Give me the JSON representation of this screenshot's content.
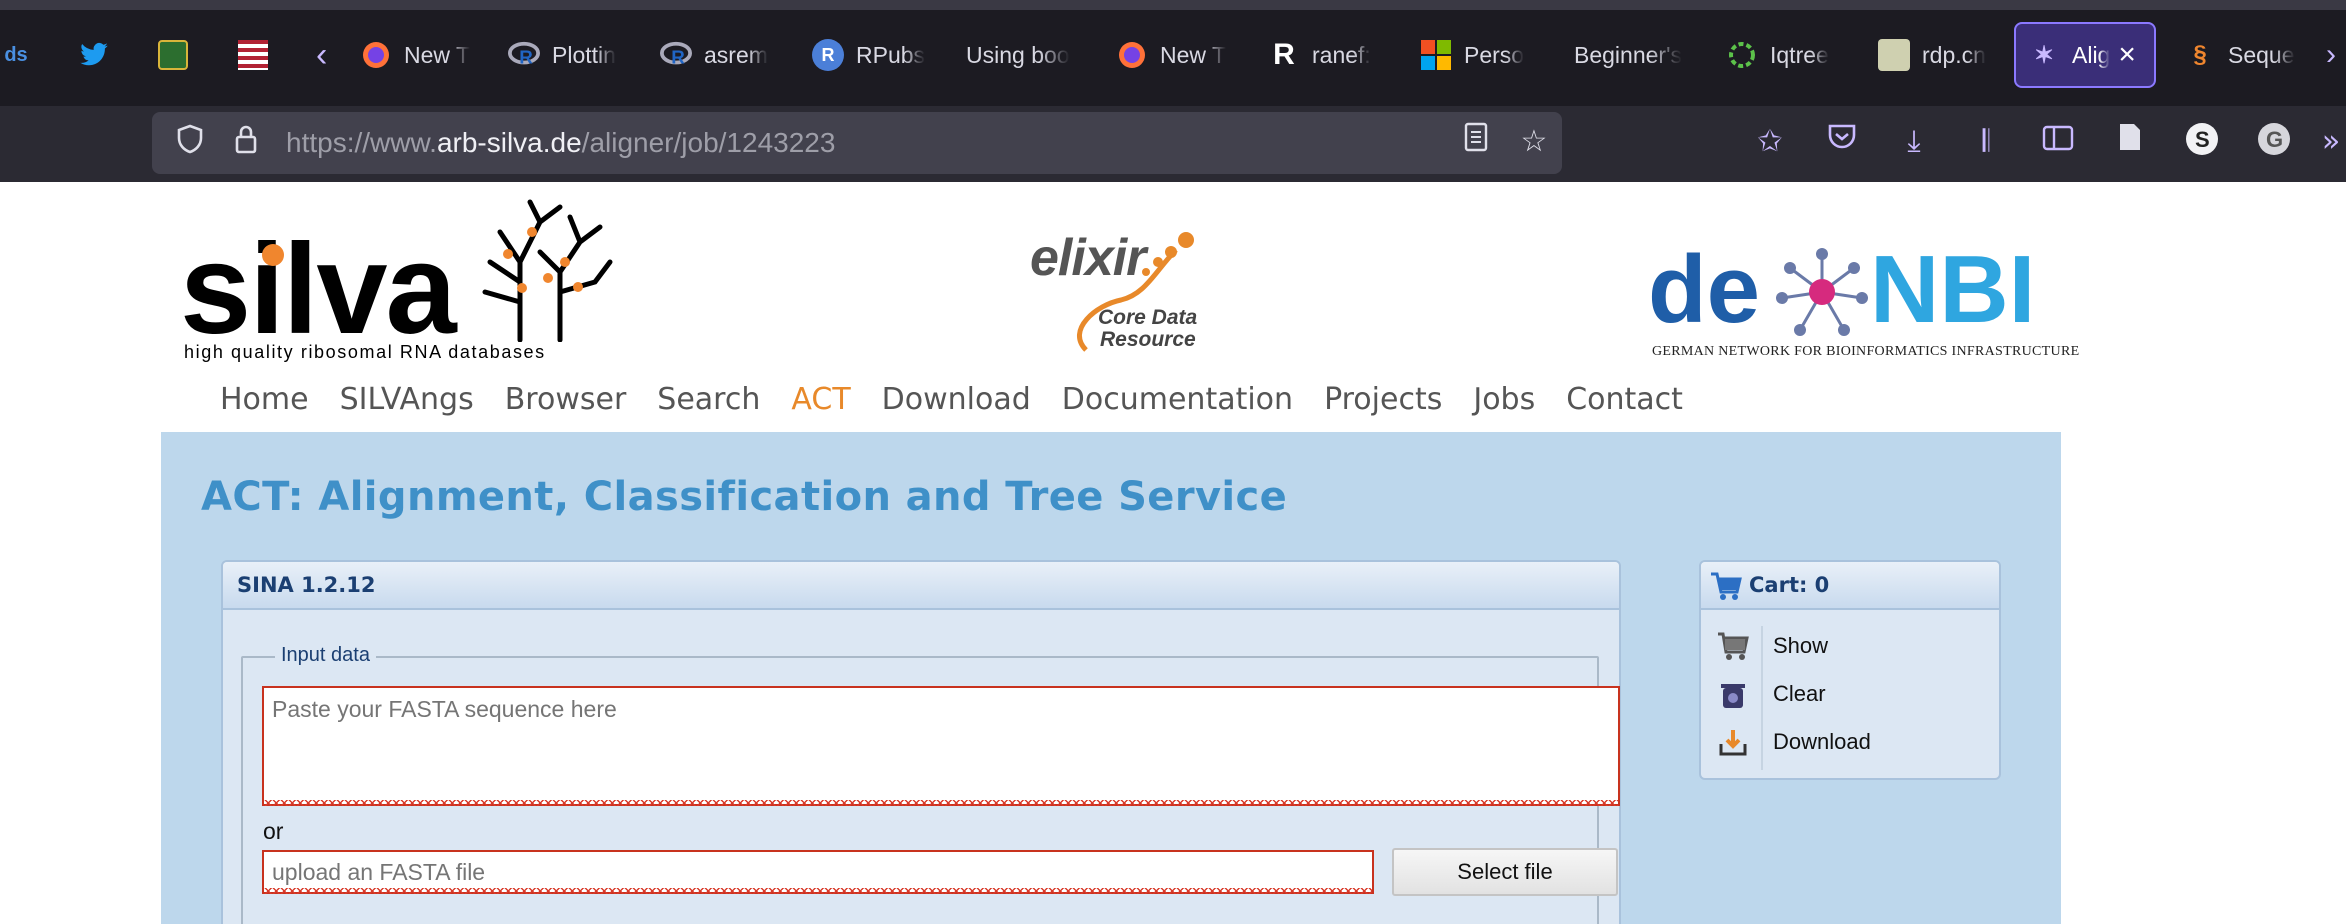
{
  "browser": {
    "tabs": [
      {
        "label": "",
        "icon": "sites-icon"
      },
      {
        "label": "",
        "icon": "twitter-icon"
      },
      {
        "label": "",
        "icon": "usfs-shield-icon"
      },
      {
        "label": "",
        "icon": "flag-icon"
      },
      {
        "label": "New T",
        "icon": "firefox-icon"
      },
      {
        "label": "Plottin",
        "icon": "r-icon"
      },
      {
        "label": "asrem",
        "icon": "r-icon"
      },
      {
        "label": "RPubs",
        "icon": "rpubs-icon"
      },
      {
        "label": "Using boo",
        "icon": ""
      },
      {
        "label": "New T",
        "icon": "firefox-icon"
      },
      {
        "label": "ranef:",
        "icon": "r-letter-icon"
      },
      {
        "label": "Perso",
        "icon": "microsoft-icon"
      },
      {
        "label": "Beginner's",
        "icon": ""
      },
      {
        "label": "Iqtree",
        "icon": "ring-icon"
      },
      {
        "label": "rdp.cn",
        "icon": "rdp-icon"
      },
      {
        "label": "Alig",
        "icon": "silva-tab-icon"
      },
      {
        "label": "Seque",
        "icon": "dna-icon"
      }
    ],
    "url_prefix": "https://www.",
    "url_domain": "arb-silva.de",
    "url_path": "/aligner/job/1243223"
  },
  "logos": {
    "silva_word": "silva",
    "silva_tagline": "high quality ribosomal RNA databases",
    "elixir_word": "elixir",
    "elixir_sub1": "Core Data",
    "elixir_sub2": "Resource",
    "denbi_de": "de",
    "denbi_nbi": "NBI",
    "denbi_tagline": "GERMAN NETWORK FOR BIOINFORMATICS INFRASTRUCTURE"
  },
  "menu": [
    "Home",
    "SILVAngs",
    "Browser",
    "Search",
    "ACT",
    "Download",
    "Documentation",
    "Projects",
    "Jobs",
    "Contact"
  ],
  "menu_active": "ACT",
  "page_title": "ACT: Alignment, Classification and Tree Service",
  "sina": {
    "header": "SINA 1.2.12",
    "legend": "Input data",
    "fasta_placeholder": "Paste your FASTA sequence here",
    "or_label": "or",
    "file_placeholder": "upload an FASTA file",
    "select_button": "Select file"
  },
  "cart": {
    "header": "Cart: 0",
    "items": [
      "Show",
      "Clear",
      "Download"
    ]
  },
  "colors": {
    "accent_orange": "#e8892a",
    "title_blue": "#3f90c8",
    "content_bg": "#bdd7ec",
    "error_red": "#c8321e"
  }
}
